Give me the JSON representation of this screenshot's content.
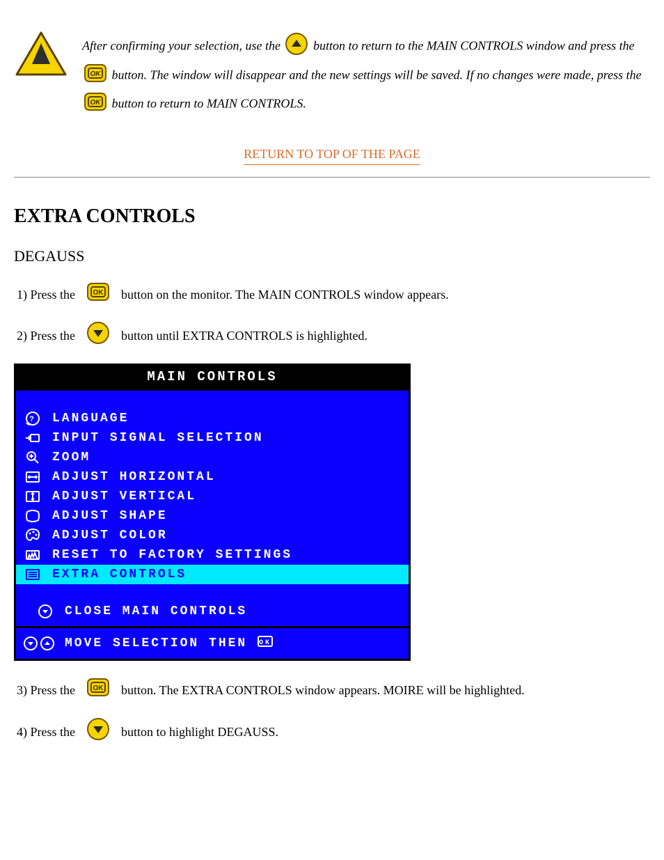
{
  "warning": {
    "part1": "After confirming your selection, use the ",
    "part2": " button to return to the MAIN CONTROLS window and press the ",
    "part3": " button. The window will disappear and the new settings will be saved. If no changes were made, press the ",
    "part4": " button to return to MAIN CONTROLS."
  },
  "link_back": "RETURN TO TOP OF THE PAGE",
  "heading": "EXTRA CONTROLS",
  "subheading": "DEGAUSS",
  "steps": {
    "s1_pre": "1) Press the ",
    "s1_post": " button on the monitor. The MAIN CONTROLS window appears.",
    "s2_pre": "2) Press the ",
    "s2_post": " button until EXTRA CONTROLS is highlighted.",
    "s3_pre": "3) Press the ",
    "s3_post": " button. The EXTRA CONTROLS window appears. MOIRE will be highlighted.",
    "s4_pre": "4) Press the ",
    "s4_post": " button to highlight DEGAUSS."
  },
  "osd": {
    "title": "MAIN CONTROLS",
    "items": [
      "LANGUAGE",
      "INPUT SIGNAL SELECTION",
      "ZOOM",
      "ADJUST HORIZONTAL",
      "ADJUST VERTICAL",
      "ADJUST SHAPE",
      "ADJUST COLOR",
      "RESET TO FACTORY SETTINGS",
      "EXTRA CONTROLS"
    ],
    "close": "CLOSE MAIN CONTROLS",
    "footer_pre": "MOVE SELECTION THEN",
    "footer_post": ""
  }
}
